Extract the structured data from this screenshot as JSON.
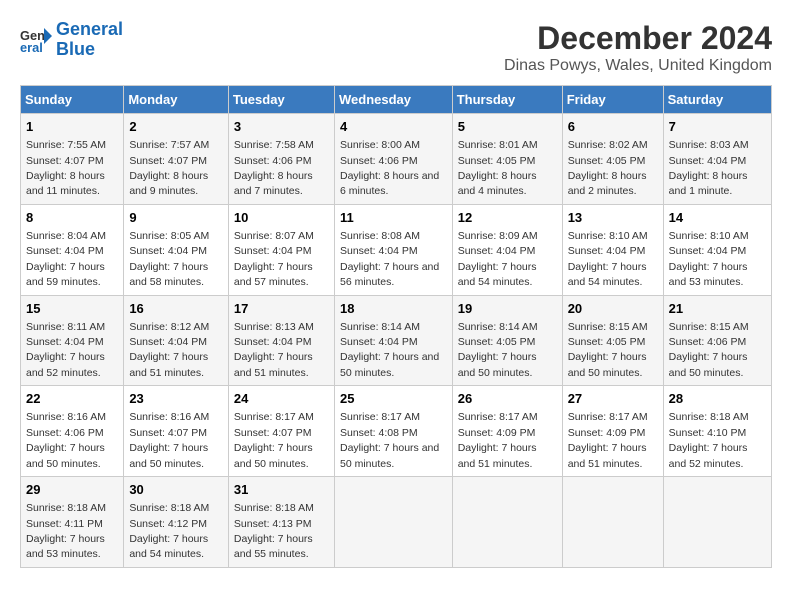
{
  "header": {
    "logo_line1": "General",
    "logo_line2": "Blue",
    "title": "December 2024",
    "subtitle": "Dinas Powys, Wales, United Kingdom"
  },
  "days_of_week": [
    "Sunday",
    "Monday",
    "Tuesday",
    "Wednesday",
    "Thursday",
    "Friday",
    "Saturday"
  ],
  "weeks": [
    [
      {
        "day": "1",
        "sunrise": "Sunrise: 7:55 AM",
        "sunset": "Sunset: 4:07 PM",
        "daylight": "Daylight: 8 hours and 11 minutes."
      },
      {
        "day": "2",
        "sunrise": "Sunrise: 7:57 AM",
        "sunset": "Sunset: 4:07 PM",
        "daylight": "Daylight: 8 hours and 9 minutes."
      },
      {
        "day": "3",
        "sunrise": "Sunrise: 7:58 AM",
        "sunset": "Sunset: 4:06 PM",
        "daylight": "Daylight: 8 hours and 7 minutes."
      },
      {
        "day": "4",
        "sunrise": "Sunrise: 8:00 AM",
        "sunset": "Sunset: 4:06 PM",
        "daylight": "Daylight: 8 hours and 6 minutes."
      },
      {
        "day": "5",
        "sunrise": "Sunrise: 8:01 AM",
        "sunset": "Sunset: 4:05 PM",
        "daylight": "Daylight: 8 hours and 4 minutes."
      },
      {
        "day": "6",
        "sunrise": "Sunrise: 8:02 AM",
        "sunset": "Sunset: 4:05 PM",
        "daylight": "Daylight: 8 hours and 2 minutes."
      },
      {
        "day": "7",
        "sunrise": "Sunrise: 8:03 AM",
        "sunset": "Sunset: 4:04 PM",
        "daylight": "Daylight: 8 hours and 1 minute."
      }
    ],
    [
      {
        "day": "8",
        "sunrise": "Sunrise: 8:04 AM",
        "sunset": "Sunset: 4:04 PM",
        "daylight": "Daylight: 7 hours and 59 minutes."
      },
      {
        "day": "9",
        "sunrise": "Sunrise: 8:05 AM",
        "sunset": "Sunset: 4:04 PM",
        "daylight": "Daylight: 7 hours and 58 minutes."
      },
      {
        "day": "10",
        "sunrise": "Sunrise: 8:07 AM",
        "sunset": "Sunset: 4:04 PM",
        "daylight": "Daylight: 7 hours and 57 minutes."
      },
      {
        "day": "11",
        "sunrise": "Sunrise: 8:08 AM",
        "sunset": "Sunset: 4:04 PM",
        "daylight": "Daylight: 7 hours and 56 minutes."
      },
      {
        "day": "12",
        "sunrise": "Sunrise: 8:09 AM",
        "sunset": "Sunset: 4:04 PM",
        "daylight": "Daylight: 7 hours and 54 minutes."
      },
      {
        "day": "13",
        "sunrise": "Sunrise: 8:10 AM",
        "sunset": "Sunset: 4:04 PM",
        "daylight": "Daylight: 7 hours and 54 minutes."
      },
      {
        "day": "14",
        "sunrise": "Sunrise: 8:10 AM",
        "sunset": "Sunset: 4:04 PM",
        "daylight": "Daylight: 7 hours and 53 minutes."
      }
    ],
    [
      {
        "day": "15",
        "sunrise": "Sunrise: 8:11 AM",
        "sunset": "Sunset: 4:04 PM",
        "daylight": "Daylight: 7 hours and 52 minutes."
      },
      {
        "day": "16",
        "sunrise": "Sunrise: 8:12 AM",
        "sunset": "Sunset: 4:04 PM",
        "daylight": "Daylight: 7 hours and 51 minutes."
      },
      {
        "day": "17",
        "sunrise": "Sunrise: 8:13 AM",
        "sunset": "Sunset: 4:04 PM",
        "daylight": "Daylight: 7 hours and 51 minutes."
      },
      {
        "day": "18",
        "sunrise": "Sunrise: 8:14 AM",
        "sunset": "Sunset: 4:04 PM",
        "daylight": "Daylight: 7 hours and 50 minutes."
      },
      {
        "day": "19",
        "sunrise": "Sunrise: 8:14 AM",
        "sunset": "Sunset: 4:05 PM",
        "daylight": "Daylight: 7 hours and 50 minutes."
      },
      {
        "day": "20",
        "sunrise": "Sunrise: 8:15 AM",
        "sunset": "Sunset: 4:05 PM",
        "daylight": "Daylight: 7 hours and 50 minutes."
      },
      {
        "day": "21",
        "sunrise": "Sunrise: 8:15 AM",
        "sunset": "Sunset: 4:06 PM",
        "daylight": "Daylight: 7 hours and 50 minutes."
      }
    ],
    [
      {
        "day": "22",
        "sunrise": "Sunrise: 8:16 AM",
        "sunset": "Sunset: 4:06 PM",
        "daylight": "Daylight: 7 hours and 50 minutes."
      },
      {
        "day": "23",
        "sunrise": "Sunrise: 8:16 AM",
        "sunset": "Sunset: 4:07 PM",
        "daylight": "Daylight: 7 hours and 50 minutes."
      },
      {
        "day": "24",
        "sunrise": "Sunrise: 8:17 AM",
        "sunset": "Sunset: 4:07 PM",
        "daylight": "Daylight: 7 hours and 50 minutes."
      },
      {
        "day": "25",
        "sunrise": "Sunrise: 8:17 AM",
        "sunset": "Sunset: 4:08 PM",
        "daylight": "Daylight: 7 hours and 50 minutes."
      },
      {
        "day": "26",
        "sunrise": "Sunrise: 8:17 AM",
        "sunset": "Sunset: 4:09 PM",
        "daylight": "Daylight: 7 hours and 51 minutes."
      },
      {
        "day": "27",
        "sunrise": "Sunrise: 8:17 AM",
        "sunset": "Sunset: 4:09 PM",
        "daylight": "Daylight: 7 hours and 51 minutes."
      },
      {
        "day": "28",
        "sunrise": "Sunrise: 8:18 AM",
        "sunset": "Sunset: 4:10 PM",
        "daylight": "Daylight: 7 hours and 52 minutes."
      }
    ],
    [
      {
        "day": "29",
        "sunrise": "Sunrise: 8:18 AM",
        "sunset": "Sunset: 4:11 PM",
        "daylight": "Daylight: 7 hours and 53 minutes."
      },
      {
        "day": "30",
        "sunrise": "Sunrise: 8:18 AM",
        "sunset": "Sunset: 4:12 PM",
        "daylight": "Daylight: 7 hours and 54 minutes."
      },
      {
        "day": "31",
        "sunrise": "Sunrise: 8:18 AM",
        "sunset": "Sunset: 4:13 PM",
        "daylight": "Daylight: 7 hours and 55 minutes."
      },
      null,
      null,
      null,
      null
    ]
  ]
}
